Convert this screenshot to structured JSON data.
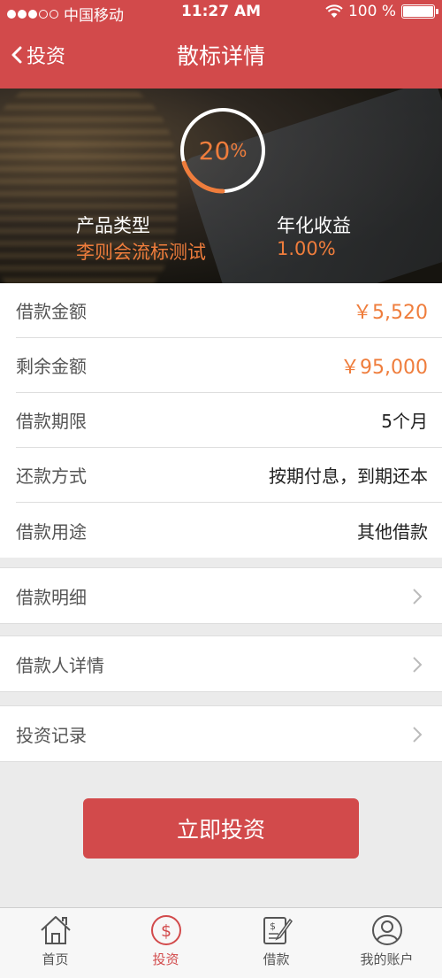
{
  "status_bar": {
    "carrier": "中国移动",
    "time": "11:27 AM",
    "battery": "100 %"
  },
  "nav": {
    "back_label": "投资",
    "title": "散标详情"
  },
  "hero": {
    "progress_text": "20",
    "progress_unit": "%",
    "progress_fraction": 0.2,
    "product_type_label": "产品类型",
    "product_type_value": "李则会流标测试",
    "annual_rate_label": "年化收益",
    "annual_rate_value": "1.00%"
  },
  "details": [
    {
      "label": "借款金额",
      "value": "￥5,520",
      "highlight": true
    },
    {
      "label": "剩余金额",
      "value": "￥95,000",
      "highlight": true
    },
    {
      "label": "借款期限",
      "value": "5个月",
      "highlight": false
    },
    {
      "label": "还款方式",
      "value": "按期付息，到期还本",
      "highlight": false
    },
    {
      "label": "借款用途",
      "value": "其他借款",
      "highlight": false
    }
  ],
  "links": {
    "loan_details": "借款明细",
    "borrower_details": "借款人详情",
    "invest_records": "投资记录"
  },
  "invest_button": "立即投资",
  "tabs": [
    {
      "label": "首页",
      "icon": "home-icon",
      "active": false
    },
    {
      "label": "投资",
      "icon": "dollar-icon",
      "active": true
    },
    {
      "label": "借款",
      "icon": "loan-note-icon",
      "active": false
    },
    {
      "label": "我的账户",
      "icon": "user-icon",
      "active": false
    }
  ],
  "colors": {
    "brand_red": "#d24a4b",
    "accent_orange": "#ef7d3c"
  }
}
